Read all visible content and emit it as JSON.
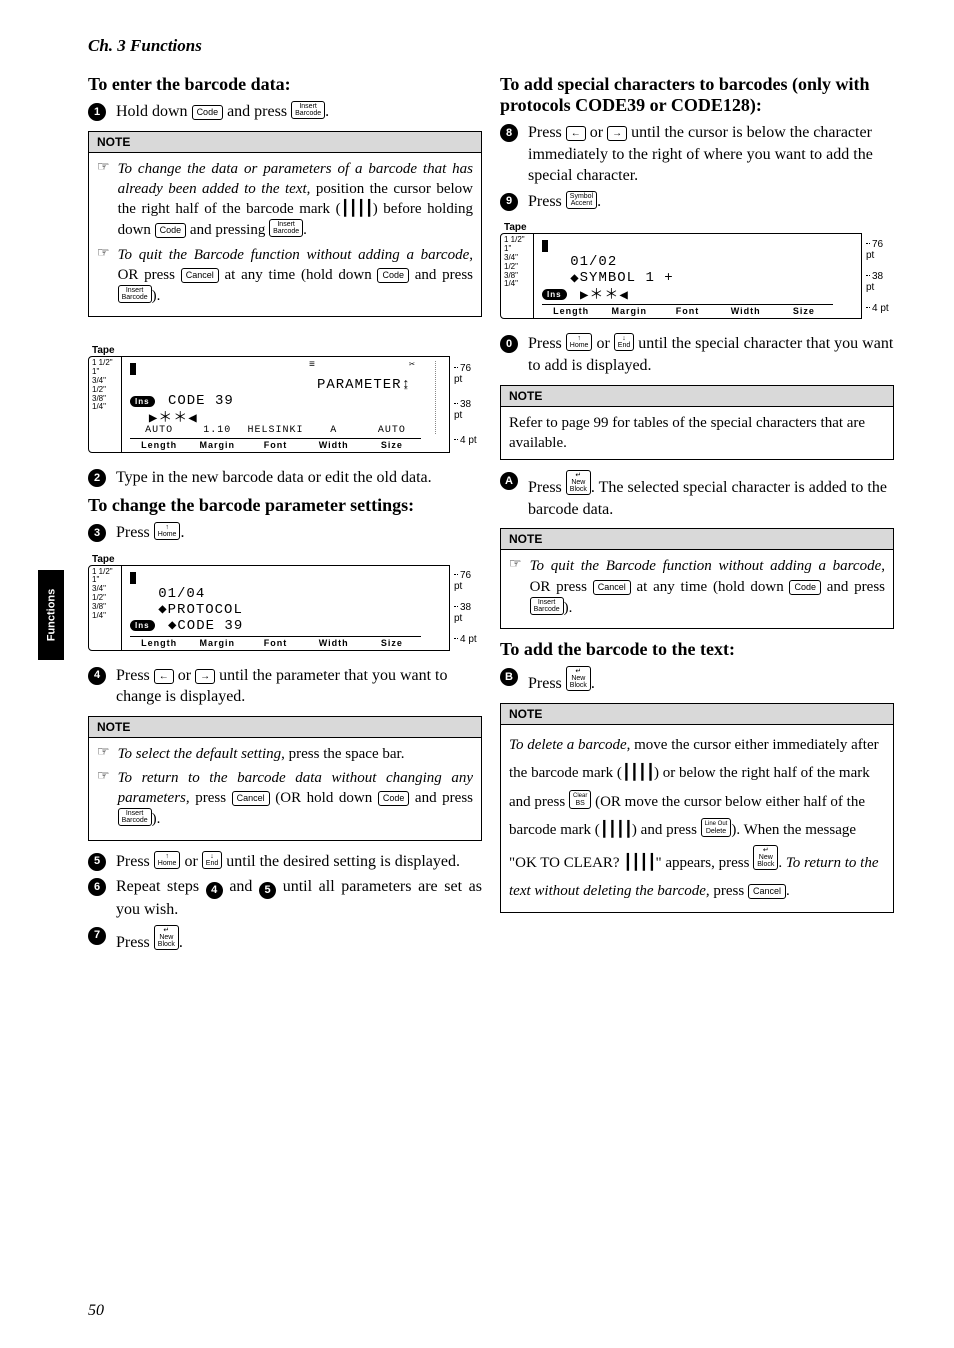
{
  "chapter": "Ch. 3 Functions",
  "sideTab": "Functions",
  "pageNumber": "50",
  "keys": {
    "code": "Code",
    "insertBarcode": "Insert\nBarcode",
    "cancel": "Cancel",
    "home": "Home",
    "end": "End",
    "symbolAccent": "Symbol\nAccent",
    "newBlock": "New\nBlock",
    "bs": "BS",
    "clear": "Clear",
    "delete": "Delete",
    "lineOut": "Line Out"
  },
  "col1": {
    "h1": "To enter the barcode data:",
    "step1_a": "Hold down ",
    "step1_b": " and press ",
    "step1_c": ".",
    "note1": {
      "item1_a": "To change the data or parameters of a barcode that has already been added to the text",
      "item1_b": ", position the cursor below the right half of the barcode mark (",
      "item1_c": ") before holding down ",
      "item1_d": " and pressing ",
      "item1_e": ".",
      "item2_a": "To quit the Barcode function without adding a barcode",
      "item2_b": ", OR press ",
      "item2_c": " at any time (hold down ",
      "item2_d": " and press ",
      "item2_e": ")."
    },
    "lcd1": {
      "line1_right": "PARAMETER",
      "line2": "CODE 39",
      "line3_left": "▶＊＊◀",
      "sub": {
        "a": "AUTO",
        "b": "1.10",
        "c": "HELSINKI",
        "d": "A",
        "e": "AUTO"
      }
    },
    "step2": "Type in the new barcode data or edit the old data.",
    "h2": "To change the barcode parameter settings:",
    "step3_a": "Press ",
    "step3_b": ".",
    "lcd2": {
      "line1": "01/04",
      "line2": "PROTOCOL",
      "line3": "CODE 39"
    },
    "step4_a": "Press ",
    "step4_b": " or ",
    "step4_c": " until the parameter that you want to change is displayed.",
    "note2": {
      "item1_a": "To select the default setting",
      "item1_b": ", press the space bar.",
      "item2_a": "To return to the barcode data without changing any parameters",
      "item2_b": ", press ",
      "item2_c": " (OR hold down ",
      "item2_d": " and press ",
      "item2_e": ")."
    },
    "step5_a": "Press ",
    "step5_b": " or ",
    "step5_c": " until the desired setting is displayed.",
    "step6_a": "Repeat steps ",
    "step6_b": " and ",
    "step6_c": " until all parameters are set as you wish.",
    "step7_a": "Press ",
    "step7_b": "."
  },
  "col2": {
    "h1": "To add special characters to barcodes (only with protocols CODE39 or CODE128):",
    "step8_a": "Press ",
    "step8_b": " or ",
    "step8_c": " until the cursor is below the character immediately to the right of where you want to add the special character.",
    "step9_a": "Press ",
    "step9_b": ".",
    "lcd3": {
      "line1": "01/02",
      "line2": "SYMBOL  1   +",
      "line3": "▶＊＊◀"
    },
    "step10_a": "Press ",
    "step10_b": " or ",
    "step10_c": " until the special character that you want to add is displayed.",
    "note3": "Refer to page 99 for tables of the special characters that are available.",
    "step11_a": "Press ",
    "step11_b": ". The selected special character is added to the barcode data.",
    "note4": {
      "item1_a": "To quit the Barcode function without adding a barcode",
      "item1_b": ", OR press ",
      "item1_c": " at any time (hold down ",
      "item1_d": " and press ",
      "item1_e": ")."
    },
    "h2": "To add the barcode to the text:",
    "step12_a": "Press ",
    "step12_b": ".",
    "note5": {
      "a": "To delete a barcode",
      "b": ", move the cursor either immediately after the barcode mark (",
      "c": ") or below the right half of the mark and press ",
      "d": " (OR move the cursor below either half of the barcode mark (",
      "e": ") and press ",
      "f": "). When the message \"OK TO CLEAR? ",
      "g": "\" appears, press ",
      "h": ". ",
      "i": "To return to the text without deleting the barcode",
      "j": ", press ",
      "k": "."
    }
  },
  "lcdCommon": {
    "tapeLabel": "Tape",
    "tapes": [
      "1 1/2\"",
      "1\"",
      "3/4\"",
      "1/2\"",
      "3/8\"",
      "1/4\""
    ],
    "pts": [
      "76 pt",
      "38 pt",
      "4 pt"
    ],
    "status": [
      "Length",
      "Margin",
      "Font",
      "Width",
      "Size"
    ],
    "ins": "Ins"
  },
  "noteLabel": "NOTE"
}
